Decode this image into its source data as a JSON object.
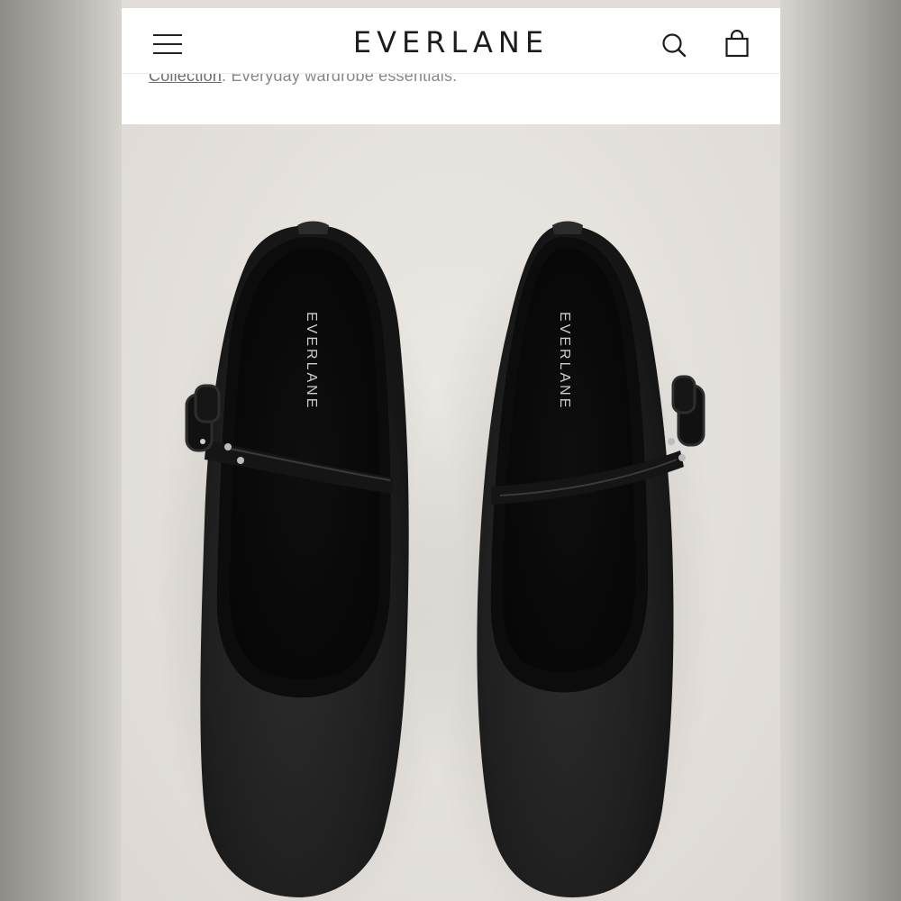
{
  "header": {
    "brand": "EVERLANE",
    "menu_icon": "hamburger-menu-icon",
    "search_icon": "search-icon",
    "bag_icon": "shopping-bag-icon"
  },
  "product": {
    "description_link": "Collection",
    "description_rest": ". Everyday wardrobe essentials.",
    "insole_brand": "EVERLANE"
  },
  "colors": {
    "nav_background": "#ffffff",
    "photo_background": "#e6e2de",
    "shoe": "#1f1f1f"
  }
}
